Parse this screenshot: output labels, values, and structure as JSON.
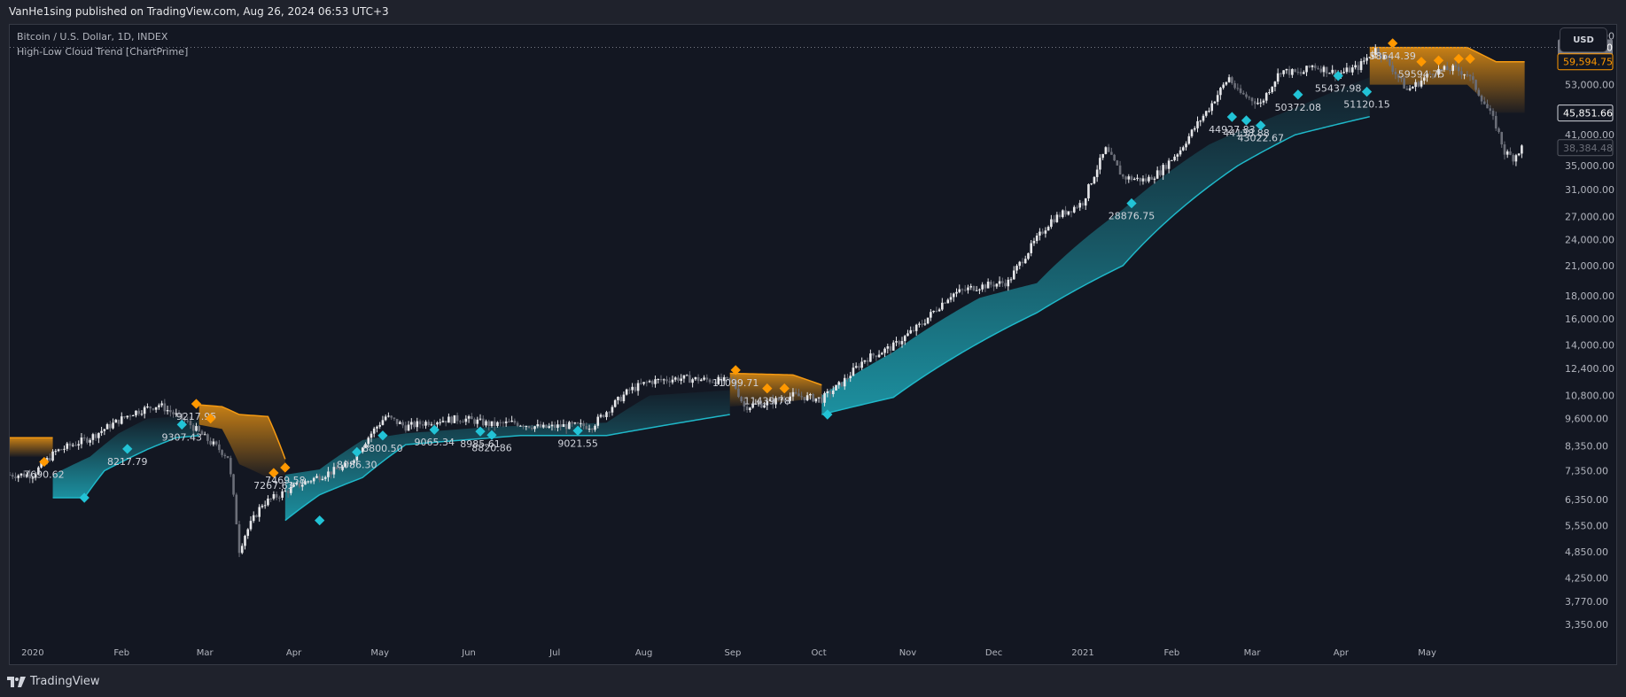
{
  "header": {
    "publisher_line": "VanHe1sing published on TradingView.com, Aug 26, 2024 06:53 UTC+3"
  },
  "legend": {
    "symbol_line": "Bitcoin / U.S. Dollar, 1D, INDEX",
    "indicator_line": "High-Low Cloud Trend [ChartPrime]"
  },
  "currency_button": "USD",
  "footer": {
    "brand": "TradingView"
  },
  "colors": {
    "background": "#131722",
    "bull_cloud": "#1fb8c9",
    "bear_cloud": "#f59a12",
    "candle_up": "#e6e7ea",
    "candle_down": "#6b6e78",
    "bull_marker": "#22c3d6",
    "bear_marker": "#ff9800"
  },
  "chart_data": {
    "type": "candlestick",
    "title": "Bitcoin / U.S. Dollar, 1D, INDEX",
    "indicator": "High-Low Cloud Trend [ChartPrime]",
    "y_scale": "log",
    "ylim": [
      3100,
      72000
    ],
    "y_ticks": [
      "68,000.00",
      "53,000.00",
      "41,000.00",
      "35,000.00",
      "31,000.00",
      "27,000.00",
      "24,000.00",
      "21,000.00",
      "18,000.00",
      "16,000.00",
      "14,000.00",
      "12,400.00",
      "10,800.00",
      "9,600.00",
      "8,350.00",
      "7,350.00",
      "6,350.00",
      "5,550.00",
      "4,850.00",
      "4,250.00",
      "3,770.00",
      "3,350.00"
    ],
    "y_tick_values": [
      68000,
      53000,
      41000,
      35000,
      31000,
      27000,
      24000,
      21000,
      18000,
      16000,
      14000,
      12400,
      10800,
      9600,
      8350,
      7350,
      6350,
      5550,
      4850,
      4250,
      3770,
      3350
    ],
    "price_labels": [
      {
        "text": "64,133.60",
        "sub": "20:06:10",
        "value": 64133.6,
        "style": "current"
      },
      {
        "text": "59,594.75",
        "value": 59594.75,
        "style": "bear"
      },
      {
        "text": "45,851.66",
        "value": 45851.66,
        "style": "outlined"
      },
      {
        "text": "38,384.48",
        "value": 38384.48,
        "style": "faded"
      }
    ],
    "x_ticks": [
      "2020",
      "Feb",
      "Mar",
      "Apr",
      "May",
      "Jun",
      "Jul",
      "Aug",
      "Sep",
      "Oct",
      "Nov",
      "Dec",
      "2021",
      "Feb",
      "Mar",
      "Apr",
      "May"
    ],
    "x_tick_days": [
      0,
      31,
      60,
      91,
      121,
      152,
      182,
      213,
      244,
      274,
      305,
      335,
      366,
      397,
      425,
      456,
      486
    ],
    "x_range_days": [
      -8,
      530
    ],
    "price_path": [
      [
        -8,
        7200
      ],
      [
        0,
        7200
      ],
      [
        8,
        8100
      ],
      [
        20,
        8700
      ],
      [
        35,
        9900
      ],
      [
        44,
        10300
      ],
      [
        55,
        9300
      ],
      [
        60,
        8700
      ],
      [
        68,
        7900
      ],
      [
        72,
        4900
      ],
      [
        74,
        5300
      ],
      [
        80,
        6200
      ],
      [
        92,
        6800
      ],
      [
        100,
        7150
      ],
      [
        110,
        7550
      ],
      [
        118,
        8900
      ],
      [
        123,
        9700
      ],
      [
        130,
        9200
      ],
      [
        140,
        9500
      ],
      [
        150,
        9600
      ],
      [
        160,
        9300
      ],
      [
        168,
        9400
      ],
      [
        178,
        9150
      ],
      [
        185,
        9250
      ],
      [
        195,
        9250
      ],
      [
        208,
        11100
      ],
      [
        215,
        11600
      ],
      [
        225,
        11800
      ],
      [
        235,
        11700
      ],
      [
        244,
        11600
      ],
      [
        248,
        10200
      ],
      [
        256,
        10400
      ],
      [
        265,
        10800
      ],
      [
        275,
        10600
      ],
      [
        282,
        11500
      ],
      [
        290,
        13000
      ],
      [
        300,
        13900
      ],
      [
        310,
        15600
      ],
      [
        320,
        18100
      ],
      [
        328,
        18800
      ],
      [
        335,
        19100
      ],
      [
        340,
        19300
      ],
      [
        348,
        23100
      ],
      [
        355,
        26500
      ],
      [
        366,
        29000
      ],
      [
        374,
        38000
      ],
      [
        380,
        33000
      ],
      [
        388,
        32500
      ],
      [
        393,
        34000
      ],
      [
        400,
        38000
      ],
      [
        410,
        47000
      ],
      [
        417,
        55000
      ],
      [
        420,
        51000
      ],
      [
        428,
        48000
      ],
      [
        435,
        57000
      ],
      [
        442,
        56000
      ],
      [
        446,
        58500
      ],
      [
        455,
        56000
      ],
      [
        462,
        58000
      ],
      [
        468,
        63500
      ],
      [
        472,
        60000
      ],
      [
        476,
        55000
      ],
      [
        479,
        51500
      ],
      [
        483,
        53500
      ],
      [
        488,
        56700
      ],
      [
        495,
        57500
      ],
      [
        500,
        56000
      ],
      [
        505,
        49500
      ],
      [
        510,
        43000
      ],
      [
        513,
        37500
      ],
      [
        516,
        36500
      ],
      [
        519,
        38384
      ]
    ],
    "cloud_segments": [
      {
        "trend": "bear",
        "from": -8,
        "to": 7,
        "upper": 8700,
        "lower": 7900
      },
      {
        "trend": "bull",
        "from": 7,
        "to": 58,
        "upper_path": [
          [
            7,
            7200
          ],
          [
            20,
            7900
          ],
          [
            30,
            8900
          ],
          [
            40,
            9600
          ],
          [
            50,
            9700
          ],
          [
            58,
            9500
          ]
        ],
        "lower_path": [
          [
            7,
            6400
          ],
          [
            18,
            6400
          ],
          [
            25,
            7350
          ],
          [
            40,
            8200
          ],
          [
            50,
            8700
          ],
          [
            58,
            8800
          ]
        ]
      },
      {
        "trend": "bear",
        "from": 58,
        "to": 88,
        "upper_path": [
          [
            58,
            10300
          ],
          [
            66,
            10200
          ],
          [
            72,
            9800
          ],
          [
            82,
            9700
          ],
          [
            88,
            7800
          ]
        ],
        "lower_path": [
          [
            58,
            9300
          ],
          [
            66,
            9100
          ],
          [
            72,
            7600
          ],
          [
            82,
            7100
          ],
          [
            88,
            7200
          ]
        ]
      },
      {
        "trend": "bull",
        "from": 88,
        "to": 243,
        "upper_path": [
          [
            88,
            7200
          ],
          [
            100,
            7400
          ],
          [
            115,
            8600
          ],
          [
            130,
            8900
          ],
          [
            160,
            9200
          ],
          [
            200,
            9400
          ],
          [
            215,
            10800
          ],
          [
            243,
            11100
          ]
        ],
        "lower_path": [
          [
            88,
            5700
          ],
          [
            100,
            6500
          ],
          [
            115,
            7100
          ],
          [
            130,
            8400
          ],
          [
            150,
            8600
          ],
          [
            170,
            8800
          ],
          [
            200,
            8800
          ],
          [
            243,
            9800
          ]
        ]
      },
      {
        "trend": "bear",
        "from": 243,
        "to": 275,
        "upper_path": [
          [
            243,
            12100
          ],
          [
            265,
            12000
          ],
          [
            275,
            11400
          ]
        ],
        "lower_path": [
          [
            243,
            10200
          ],
          [
            265,
            10500
          ],
          [
            275,
            10700
          ]
        ]
      },
      {
        "trend": "bull",
        "from": 275,
        "to": 466,
        "upper_path": [
          [
            275,
            10800
          ],
          [
            300,
            13500
          ],
          [
            330,
            17800
          ],
          [
            350,
            19200
          ],
          [
            380,
            28000
          ],
          [
            410,
            39000
          ],
          [
            440,
            47000
          ],
          [
            466,
            55000
          ]
        ],
        "lower_path": [
          [
            275,
            9800
          ],
          [
            300,
            10700
          ],
          [
            320,
            13000
          ],
          [
            350,
            16500
          ],
          [
            380,
            21000
          ],
          [
            400,
            28000
          ],
          [
            420,
            35000
          ],
          [
            440,
            41000
          ],
          [
            466,
            45000
          ]
        ]
      },
      {
        "trend": "bear",
        "from": 466,
        "to": 520,
        "upper_path": [
          [
            466,
            64100
          ],
          [
            500,
            64100
          ],
          [
            510,
            59600
          ],
          [
            520,
            59600
          ]
        ],
        "lower_path": [
          [
            466,
            53000
          ],
          [
            500,
            53000
          ],
          [
            510,
            45900
          ],
          [
            520,
            45900
          ]
        ]
      }
    ],
    "annotations": [
      {
        "trend": "bear",
        "day": 4,
        "value": 7690.62,
        "label": "7690.62"
      },
      {
        "trend": "bull",
        "day": 18,
        "value": 6400,
        "label": ""
      },
      {
        "trend": "bull",
        "day": 33,
        "value": 8217.79,
        "label": "8217.79"
      },
      {
        "trend": "bull",
        "day": 52,
        "value": 9307.43,
        "label": "9307.43"
      },
      {
        "trend": "bear",
        "day": 57,
        "value": 10350,
        "label": "9217.95"
      },
      {
        "trend": "bear",
        "day": 62,
        "value": 9600,
        "label": ""
      },
      {
        "trend": "bear",
        "day": 84,
        "value": 7267.63,
        "label": "7267.63"
      },
      {
        "trend": "bear",
        "day": 88,
        "value": 7469.58,
        "label": "7469.58"
      },
      {
        "trend": "bull",
        "day": 100,
        "value": 5700,
        "label": ""
      },
      {
        "trend": "bull",
        "day": 113,
        "value": 8086.3,
        "label": "8086.30"
      },
      {
        "trend": "bull",
        "day": 122,
        "value": 8800.5,
        "label": "8800.50"
      },
      {
        "trend": "bull",
        "day": 140,
        "value": 9065.34,
        "label": "9065.34"
      },
      {
        "trend": "bull",
        "day": 156,
        "value": 8985.61,
        "label": "8985.61"
      },
      {
        "trend": "bull",
        "day": 160,
        "value": 8820.86,
        "label": "8820.86"
      },
      {
        "trend": "bull",
        "day": 190,
        "value": 9021.55,
        "label": "9021.55"
      },
      {
        "trend": "bear",
        "day": 245,
        "value": 12300,
        "label": "11099.71"
      },
      {
        "trend": "bear",
        "day": 256,
        "value": 11200,
        "label": "11439.78"
      },
      {
        "trend": "bear",
        "day": 262,
        "value": 11200,
        "label": ""
      },
      {
        "trend": "bull",
        "day": 277,
        "value": 9800,
        "label": ""
      },
      {
        "trend": "bull",
        "day": 383,
        "value": 28876.75,
        "label": "28876.75"
      },
      {
        "trend": "bull",
        "day": 418,
        "value": 44927.83,
        "label": "44927.83"
      },
      {
        "trend": "bull",
        "day": 423,
        "value": 44138.88,
        "label": "44138.88"
      },
      {
        "trend": "bull",
        "day": 428,
        "value": 43022.67,
        "label": "43022.67"
      },
      {
        "trend": "bull",
        "day": 441,
        "value": 50372.08,
        "label": "50372.08"
      },
      {
        "trend": "bull",
        "day": 455,
        "value": 55437.98,
        "label": "55437.98"
      },
      {
        "trend": "bull",
        "day": 465,
        "value": 51120.15,
        "label": "51120.15"
      },
      {
        "trend": "bear",
        "day": 474,
        "value": 65500,
        "label": "58544.39"
      },
      {
        "trend": "bear",
        "day": 484,
        "value": 59594.75,
        "label": "59594.75"
      },
      {
        "trend": "bear",
        "day": 490,
        "value": 60000,
        "label": ""
      },
      {
        "trend": "bear",
        "day": 497,
        "value": 60500,
        "label": ""
      },
      {
        "trend": "bear",
        "day": 501,
        "value": 60500,
        "label": ""
      }
    ],
    "current_price_line": 64133.6
  }
}
